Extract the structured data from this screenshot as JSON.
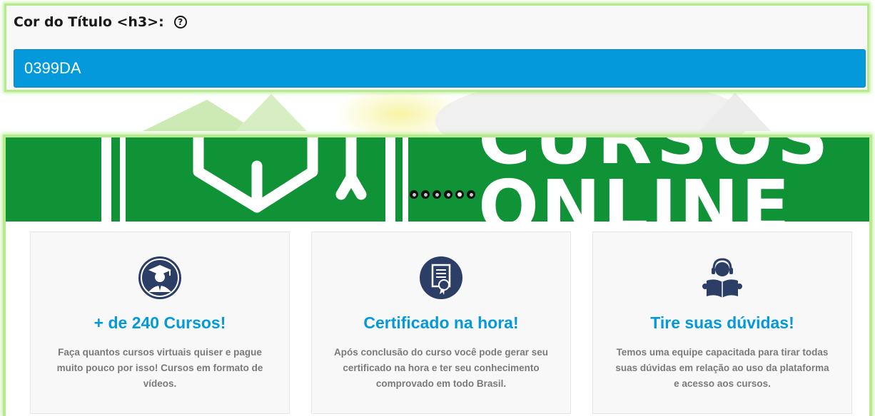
{
  "settings": {
    "title_color_label": "Cor do Título <h3>:",
    "help_icon": "question-circle-icon",
    "title_color_value": "0399DA"
  },
  "banner": {
    "line1": "CURSOS",
    "line2": "ONLINE",
    "background_color": "#0f9336",
    "slide_count": 6,
    "active_slide": 5
  },
  "features": [
    {
      "icon": "graduate-icon",
      "title": "+ de 240 Cursos!",
      "text": "Faça quantos cursos virtuais quiser e pague muito pouco por isso! Cursos em formato de vídeos."
    },
    {
      "icon": "certificate-icon",
      "title": "Certificado na hora!",
      "text": "Após conclusão do curso você pode gerar seu certificado na hora e ter seu conhecimento comprovado em todo Brasil."
    },
    {
      "icon": "support-reader-icon",
      "title": "Tire suas dúvidas!",
      "text": "Temos uma equipe capacitada para tirar todas suas dúvidas em relação ao uso da plataforma e acesso aos cursos."
    }
  ],
  "colors": {
    "accent": "#0399da",
    "icon_navy": "#2c3e66",
    "highlight_border": "#b7e98f"
  }
}
